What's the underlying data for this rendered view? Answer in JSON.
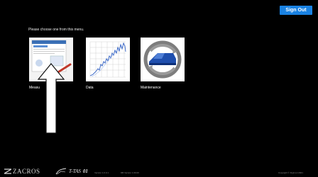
{
  "header": {
    "signout_label": "Sign Out"
  },
  "menu": {
    "prompt": "Please choose one from this menu.",
    "items": [
      {
        "label": "Measu",
        "icon": "measurement-icon"
      },
      {
        "label": "Data",
        "icon": "data-chart-icon"
      },
      {
        "label": "Maintenance",
        "icon": "maintenance-icon"
      }
    ]
  },
  "footer": {
    "brand": "ZACROS",
    "product": "T-TAS",
    "product_suffix": "01",
    "version_left": "Version 1.0.0.1",
    "version_right": "DB Version 1.00.00",
    "copyright": "Copyright © Fujimori 2021"
  },
  "colors": {
    "accent": "#1a82e2",
    "background": "#000000"
  }
}
